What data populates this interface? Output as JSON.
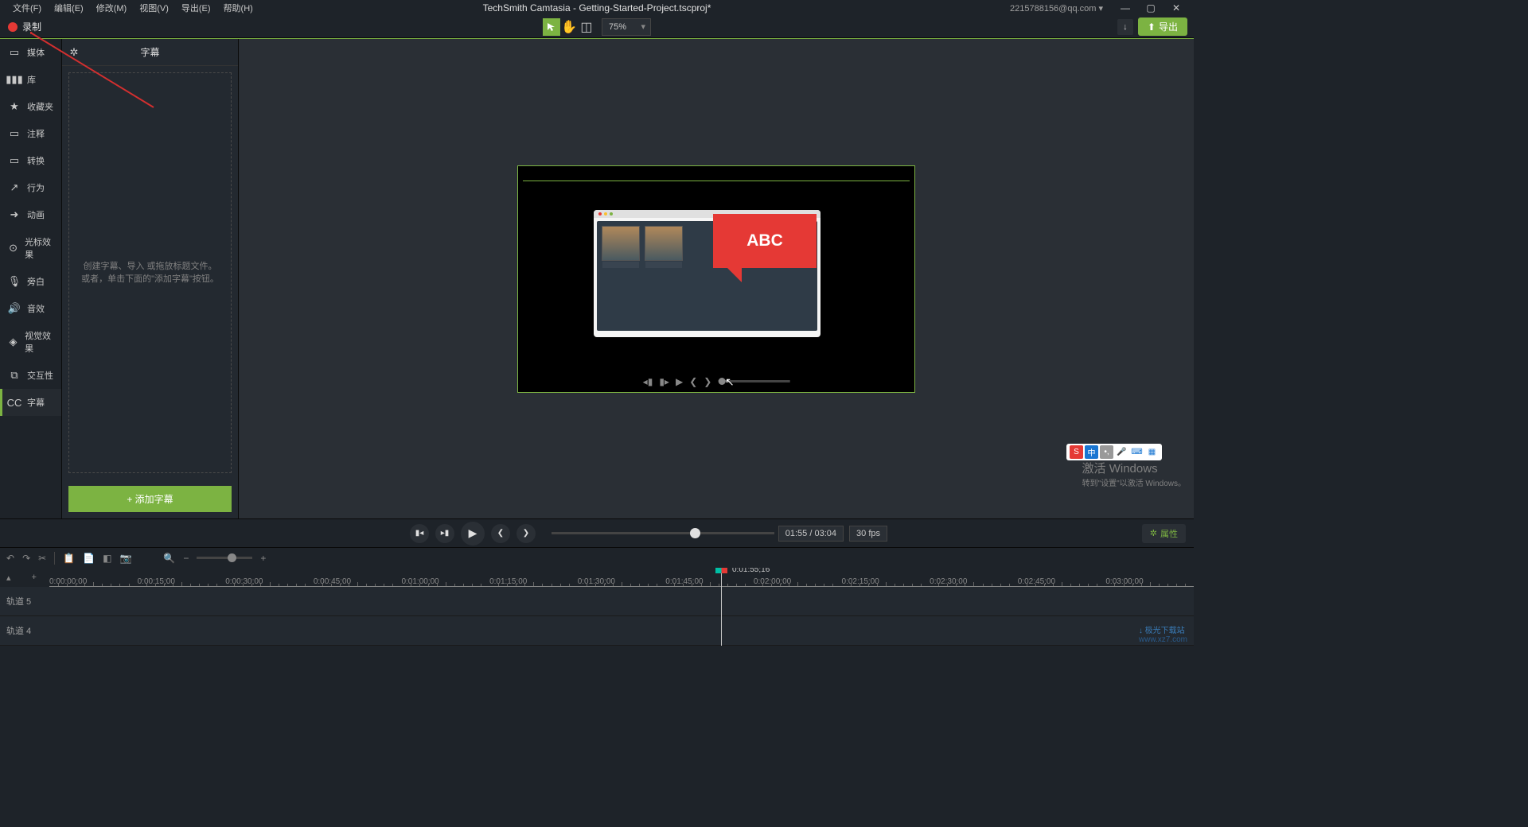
{
  "menu": [
    "文件(F)",
    "编辑(E)",
    "修改(M)",
    "视图(V)",
    "导出(E)",
    "帮助(H)"
  ],
  "title": "TechSmith Camtasia - Getting-Started-Project.tscproj*",
  "account": "2215788156@qq.com ▾",
  "record_label": "录制",
  "zoom_value": "75%",
  "export_label": "导出",
  "sidebar": [
    {
      "icon": "▭",
      "label": "媒体"
    },
    {
      "icon": "▮▮▮",
      "label": "库"
    },
    {
      "icon": "★",
      "label": "收藏夹"
    },
    {
      "icon": "▭",
      "label": "注释"
    },
    {
      "icon": "▭",
      "label": "转换"
    },
    {
      "icon": "↗",
      "label": "行为"
    },
    {
      "icon": "➜",
      "label": "动画"
    },
    {
      "icon": "⊙",
      "label": "光标效果"
    },
    {
      "icon": "🎙",
      "label": "旁白"
    },
    {
      "icon": "🔊",
      "label": "音效"
    },
    {
      "icon": "◈",
      "label": "视觉效果"
    },
    {
      "icon": "⧉",
      "label": "交互性"
    },
    {
      "icon": "CC",
      "label": "字幕"
    }
  ],
  "panel": {
    "title": "字幕",
    "message": "创建字幕、导入 或拖放标题文件。或者，单击下面的\"添加字幕\"按钮。",
    "add_button": "+  添加字幕"
  },
  "callout_text": "ABC",
  "playback": {
    "time": "01:55 / 03:04",
    "fps": "30 fps",
    "properties": "属性"
  },
  "timeline": {
    "playhead_time": "0:01:55;16",
    "ticks": [
      "0:00:00;00",
      "0:00:15;00",
      "0:00:30;00",
      "0:00:45;00",
      "0:01:00;00",
      "0:01:15;00",
      "0:01:30;00",
      "0:01:45;00",
      "0:02:00;00",
      "0:02:15;00",
      "0:02:30;00",
      "0:02:45;00",
      "0:03:00;00"
    ],
    "tracks": [
      "轨道 5",
      "轨道 4"
    ]
  },
  "watermark": {
    "t1": "激活 Windows",
    "t2": "转到\"设置\"以激活 Windows。",
    "logo": "极光下载站"
  },
  "ime": {
    "s": "S",
    "cn": "中"
  }
}
